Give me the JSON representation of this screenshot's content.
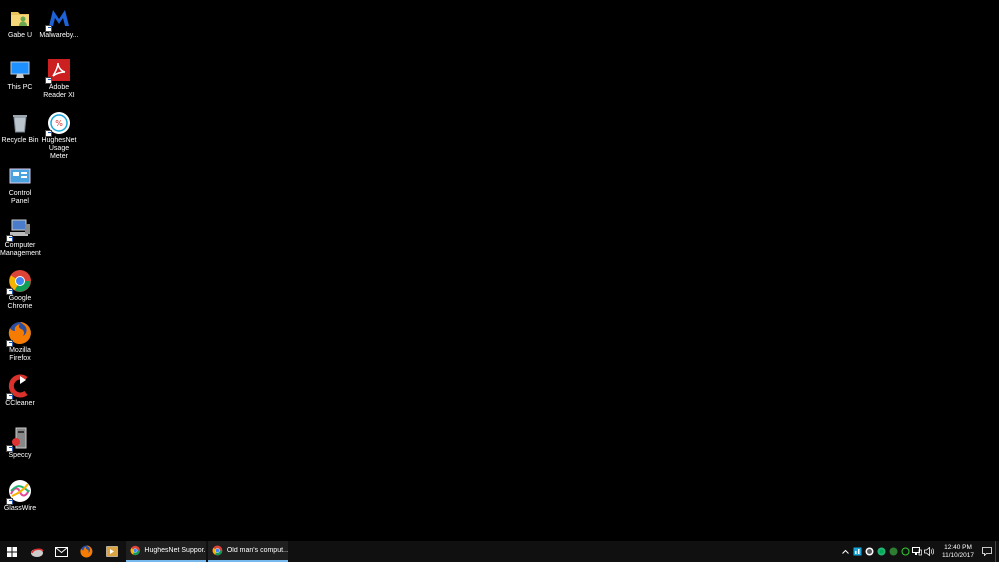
{
  "desktop": {
    "icons": [
      {
        "label": "Gabe U",
        "icon": "user-folder-icon"
      },
      {
        "label": "Malwareby...",
        "icon": "malwarebytes-icon"
      },
      {
        "label": "This PC",
        "icon": "this-pc-icon"
      },
      {
        "label": "Adobe Reader XI",
        "icon": "adobe-reader-icon"
      },
      {
        "label": "Recycle Bin",
        "icon": "recycle-bin-icon"
      },
      {
        "label": "HughesNet Usage Meter",
        "icon": "hughesnet-meter-icon"
      },
      {
        "label": "Control Panel",
        "icon": "control-panel-icon"
      },
      {
        "label": "Computer Management",
        "icon": "computer-management-icon"
      },
      {
        "label": "Google Chrome",
        "icon": "chrome-icon"
      },
      {
        "label": "Mozilla Firefox",
        "icon": "firefox-icon"
      },
      {
        "label": "CCleaner",
        "icon": "ccleaner-icon"
      },
      {
        "label": "Speccy",
        "icon": "speccy-icon"
      },
      {
        "label": "GlassWire",
        "icon": "glasswire-icon"
      }
    ]
  },
  "taskbar": {
    "windows": [
      {
        "title": "HughesNet Suppor...",
        "icon": "chrome-icon"
      },
      {
        "title": "Old man's comput...",
        "icon": "chrome-icon"
      }
    ],
    "clock": {
      "time": "12:40 PM",
      "date": "11/10/2017"
    }
  }
}
